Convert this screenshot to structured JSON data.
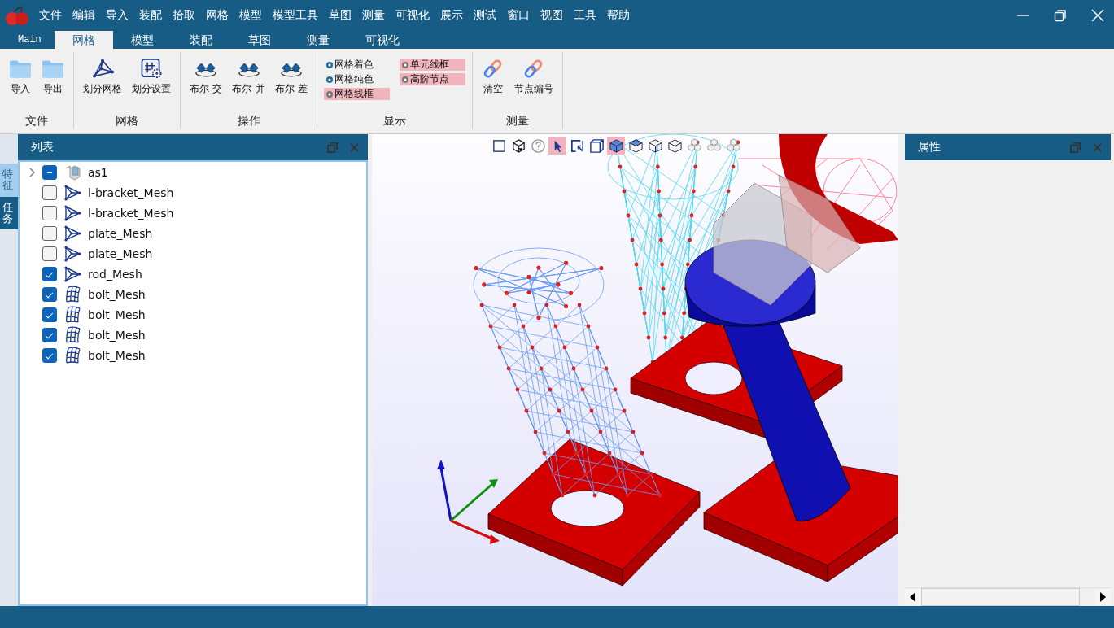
{
  "menu": [
    "文件",
    "编辑",
    "导入",
    "装配",
    "拾取",
    "网格",
    "模型",
    "模型工具",
    "草图",
    "测量",
    "可视化",
    "展示",
    "测试",
    "窗口",
    "视图",
    "工具",
    "帮助"
  ],
  "ribbon_tabs": [
    {
      "label": "Main",
      "selected": false
    },
    {
      "label": "网格",
      "selected": true
    },
    {
      "label": "模型",
      "selected": false
    },
    {
      "label": "装配",
      "selected": false
    },
    {
      "label": "草图",
      "selected": false
    },
    {
      "label": "测量",
      "selected": false
    },
    {
      "label": "可视化",
      "selected": false
    }
  ],
  "ribbon_groups": [
    {
      "label": "文件",
      "kind": "buttons",
      "buttons": [
        {
          "label": "导入",
          "kind": "folder"
        },
        {
          "label": "导出",
          "kind": "folder"
        }
      ]
    },
    {
      "label": "网格",
      "kind": "buttons",
      "buttons": [
        {
          "label": "划分网格",
          "kind": "mesh"
        },
        {
          "label": "划分设置",
          "kind": "grid-gear"
        }
      ]
    },
    {
      "label": "操作",
      "kind": "buttons",
      "buttons": [
        {
          "label": "布尔-交",
          "kind": "boolean"
        },
        {
          "label": "布尔-并",
          "kind": "boolean"
        },
        {
          "label": "布尔-差",
          "kind": "boolean"
        }
      ]
    },
    {
      "label": "显示",
      "kind": "toggles",
      "toggles": [
        {
          "label": "网格着色",
          "selected": false
        },
        {
          "label": "单元线框",
          "selected": true
        },
        {
          "label": "网格纯色",
          "selected": false
        },
        {
          "label": "高阶节点",
          "selected": true
        },
        {
          "label": "网格线框",
          "selected": true
        }
      ]
    },
    {
      "label": "测量",
      "kind": "buttons",
      "buttons": [
        {
          "label": "清空",
          "kind": "link"
        },
        {
          "label": "节点编号",
          "kind": "link"
        }
      ]
    }
  ],
  "side_tabs": [
    {
      "label": "特征",
      "selected": false
    },
    {
      "label": "任务",
      "selected": true
    }
  ],
  "list_panel": {
    "title": "列表",
    "items": [
      {
        "label": "as1",
        "kind": "assembly",
        "expanded": false,
        "checked": true,
        "partial": true
      },
      {
        "label": "l-bracket_Mesh",
        "kind": "solid_mesh",
        "checked": false,
        "partial": false
      },
      {
        "label": "l-bracket_Mesh",
        "kind": "solid_mesh",
        "checked": false,
        "partial": false
      },
      {
        "label": "plate_Mesh",
        "kind": "solid_mesh",
        "checked": false,
        "partial": false
      },
      {
        "label": "plate_Mesh",
        "kind": "solid_mesh",
        "checked": false,
        "partial": false
      },
      {
        "label": "rod_Mesh",
        "kind": "solid_mesh",
        "checked": true,
        "partial": false
      },
      {
        "label": "bolt_Mesh",
        "kind": "surface_mesh",
        "checked": true,
        "partial": false
      },
      {
        "label": "bolt_Mesh",
        "kind": "surface_mesh",
        "checked": true,
        "partial": false
      },
      {
        "label": "bolt_Mesh",
        "kind": "surface_mesh",
        "checked": true,
        "partial": false
      },
      {
        "label": "bolt_Mesh",
        "kind": "surface_mesh",
        "checked": true,
        "partial": false
      }
    ]
  },
  "view_toolbar": [
    {
      "kind": "fit",
      "selected": false
    },
    {
      "kind": "view-cube",
      "selected": false
    },
    {
      "kind": "help",
      "selected": false
    },
    {
      "kind": "pointer",
      "selected": true
    },
    {
      "kind": "box-select",
      "selected": false
    },
    {
      "kind": "box-view",
      "selected": false
    },
    {
      "kind": "cube-solid",
      "selected": true
    },
    {
      "kind": "cube-top",
      "selected": false
    },
    {
      "kind": "cube-side",
      "selected": false
    },
    {
      "kind": "cube-edge",
      "selected": false
    },
    {
      "kind": "cube-stack",
      "selected": false
    },
    {
      "kind": "cube-stack",
      "selected": false
    },
    {
      "kind": "cube-stack",
      "selected": false
    }
  ],
  "properties_panel": {
    "title": "属性"
  }
}
